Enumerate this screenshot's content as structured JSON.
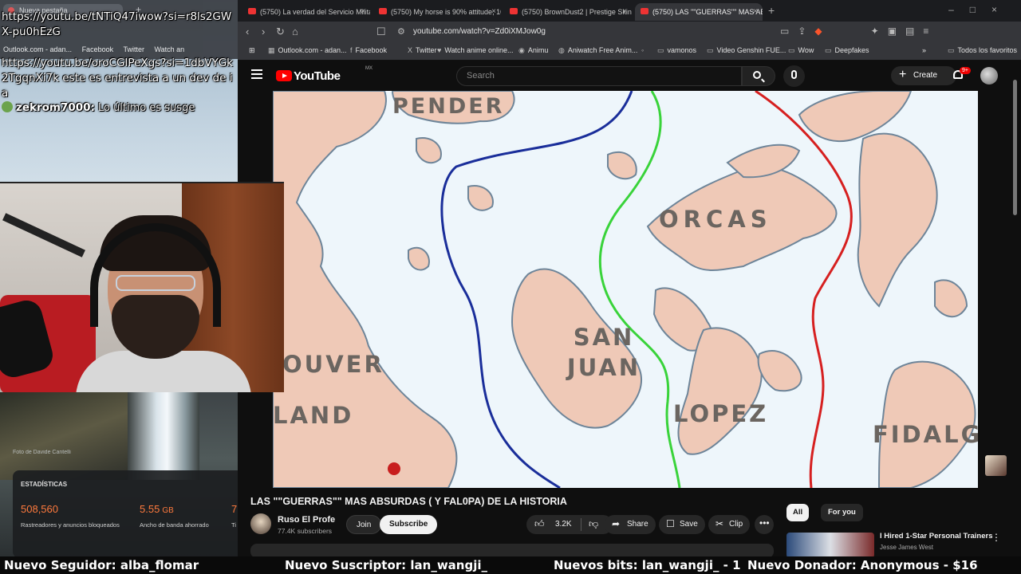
{
  "stream": {
    "mini_browser": {
      "tab_label": "Nueva pestaña",
      "bookmarks": [
        "Outlook.com - adan...",
        "Facebook",
        "Twitter",
        "Watch an"
      ]
    },
    "chat": [
      {
        "text": "https://youtu.be/tNTiQ47iwow?si=r8ls2GWX-pu0hEzG"
      },
      {
        "text": "https://youtu.be/oroCGIPeXgs?si=1dbVYGk2TgqnXi7k este es entrevista a un dev de ia"
      }
    ],
    "chat_message": {
      "user": "zekrom7000:",
      "text": "Lo último es susge"
    },
    "stats": {
      "photo_credit": "Foto de Davide Cantelli",
      "title": "ESTADÍSTICAS",
      "items": [
        {
          "value": "508,560",
          "unit": "",
          "label": "Rastreadores y anuncios bloqueados",
          "color": "#ff7a3d"
        },
        {
          "value": "5.55",
          "unit": "GB",
          "label": "Ancho de banda ahorrado",
          "color": "#ff7a3d"
        },
        {
          "value": "7",
          "unit": "",
          "label": "Ti",
          "color": "#ff7a3d"
        }
      ]
    }
  },
  "browser": {
    "tabs": [
      {
        "label": "(5750) La verdad del Servicio Militar",
        "active": false
      },
      {
        "label": "(5750) My horse is 90% attitude, 10%",
        "active": false
      },
      {
        "label": "(5750) BrownDust2 | Prestige Skin -",
        "active": false
      },
      {
        "label": "(5750) LAS \"\"GUERRAS\"\" MAS AB",
        "active": true
      }
    ],
    "url": "youtube.com/watch?v=Zd0iXMJow0g",
    "bookmarks": [
      "Outlook.com - adan...",
      "Facebook",
      "Twitter",
      "Watch anime online...",
      "Animu",
      "Aniwatch Free Anim...",
      "",
      "vamonos",
      "Video Genshin FUE...",
      "Wow",
      "Deepfakes"
    ],
    "all_bookmarks": "Todos los favoritos"
  },
  "youtube": {
    "logo": "YouTube",
    "region": "MX",
    "search_placeholder": "Search",
    "create_label": "Create",
    "notif_count": "9+",
    "map_labels": [
      "PENDER",
      "ORCAS",
      "SAN JUAN",
      "OUVER",
      "LAND",
      "LOPEZ",
      "FIDALGO"
    ],
    "video_title": "LAS \"\"GUERRAS\"\" MAS ABSURDAS ( Y FAL0PA) DE LA HISTORIA",
    "channel": {
      "name": "Ruso El Profe",
      "subs": "77.4K subscribers"
    },
    "join_label": "Join",
    "subscribe_label": "Subscribe",
    "likes": "3.2K",
    "share_label": "Share",
    "save_label": "Save",
    "clip_label": "Clip",
    "chips": [
      "All",
      "For you"
    ],
    "recommendation": {
      "title": "I Hired 1-Star Personal Trainers",
      "channel": "Jesse James West"
    }
  },
  "ticker": {
    "follower": "Nuevo Seguidor: alba_flomar",
    "subscriber": "Nuevo Suscriptor: lan_wangji_",
    "bits": "Nuevos bits: lan_wangji_ - 1",
    "donor": "Nuevo Donador: Anonymous - $16"
  }
}
